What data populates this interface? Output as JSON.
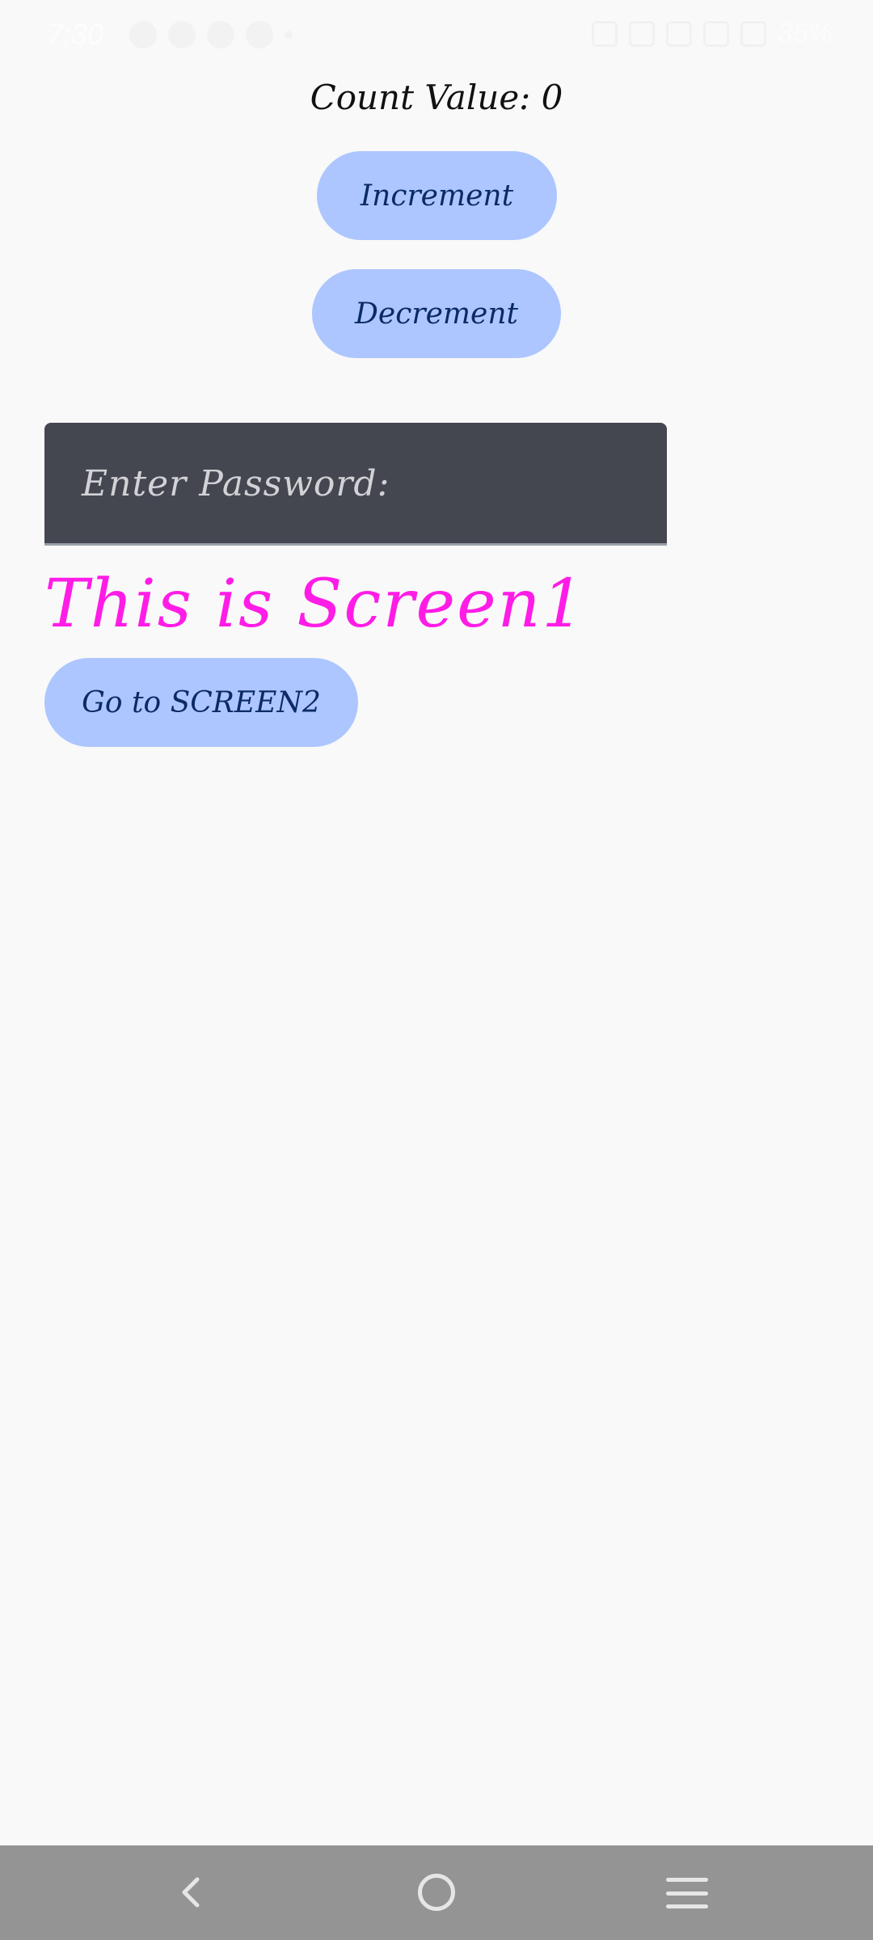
{
  "status_bar": {
    "time": "7:30",
    "battery": "35%"
  },
  "counter": {
    "label": "Count Value: 0"
  },
  "buttons": {
    "increment": "Increment",
    "decrement": "Decrement",
    "go_screen2": "Go to SCREEN2"
  },
  "password": {
    "placeholder": "Enter Password:"
  },
  "screen": {
    "title": "This is Screen1"
  },
  "colors": {
    "background": "#f9f9f9",
    "button_fill": "#adc6ff",
    "button_text": "#0b2a66",
    "title_magenta": "#ff1ce6",
    "field_fill": "#444750",
    "nav_bar": "#949494"
  },
  "icons": {
    "nav_back": "chevron-left-icon",
    "nav_home": "circle-home-icon",
    "nav_recents": "menu-lines-icon"
  }
}
